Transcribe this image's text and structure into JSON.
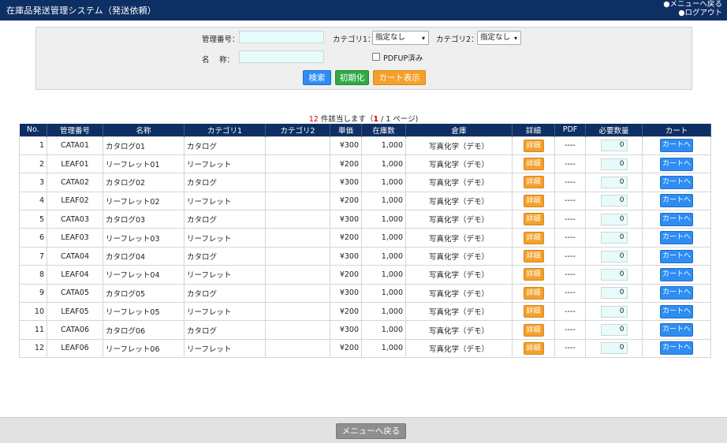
{
  "header": {
    "title": "在庫品発送管理システム（発送依頼）",
    "link_menu": "●メニューへ戻る",
    "link_logout": "●ログアウト"
  },
  "search": {
    "label_code": "管理番号：",
    "label_name": "名　 称：",
    "label_cat1": "カテゴリ1：",
    "label_cat2": "カテゴリ2：",
    "cat1_value": "指定なし",
    "cat2_value": "指定なし",
    "code_value": "",
    "name_value": "",
    "pdf_label": "PDFUP済み",
    "btn_search": "検索",
    "btn_reset": "初期化",
    "btn_cart": "カート表示"
  },
  "result": {
    "count": "12",
    "count_text": "件該当します（",
    "page": "1",
    "page_total": "/ 1 ページ)"
  },
  "table": {
    "headers": [
      "No.",
      "管理番号",
      "名称",
      "カテゴリ1",
      "カテゴリ2",
      "単価",
      "在庫数",
      "倉庫",
      "詳細",
      "PDF",
      "必要数量",
      "カート"
    ],
    "detail_label": "詳細",
    "cart_label": "カートへ",
    "rows": [
      {
        "no": "1",
        "code": "CATA01",
        "name": "カタログ01",
        "cat1": "カタログ",
        "cat2": "",
        "price": "¥300",
        "stock": "1,000",
        "warehouse": "写真化学（デモ）",
        "pdf": "----",
        "qty": "0"
      },
      {
        "no": "2",
        "code": "LEAF01",
        "name": "リーフレット01",
        "cat1": "リーフレット",
        "cat2": "",
        "price": "¥200",
        "stock": "1,000",
        "warehouse": "写真化学（デモ）",
        "pdf": "----",
        "qty": "0"
      },
      {
        "no": "3",
        "code": "CATA02",
        "name": "カタログ02",
        "cat1": "カタログ",
        "cat2": "",
        "price": "¥300",
        "stock": "1,000",
        "warehouse": "写真化学（デモ）",
        "pdf": "----",
        "qty": "0"
      },
      {
        "no": "4",
        "code": "LEAF02",
        "name": "リーフレット02",
        "cat1": "リーフレット",
        "cat2": "",
        "price": "¥200",
        "stock": "1,000",
        "warehouse": "写真化学（デモ）",
        "pdf": "----",
        "qty": "0"
      },
      {
        "no": "5",
        "code": "CATA03",
        "name": "カタログ03",
        "cat1": "カタログ",
        "cat2": "",
        "price": "¥300",
        "stock": "1,000",
        "warehouse": "写真化学（デモ）",
        "pdf": "----",
        "qty": "0"
      },
      {
        "no": "6",
        "code": "LEAF03",
        "name": "リーフレット03",
        "cat1": "リーフレット",
        "cat2": "",
        "price": "¥200",
        "stock": "1,000",
        "warehouse": "写真化学（デモ）",
        "pdf": "----",
        "qty": "0"
      },
      {
        "no": "7",
        "code": "CATA04",
        "name": "カタログ04",
        "cat1": "カタログ",
        "cat2": "",
        "price": "¥300",
        "stock": "1,000",
        "warehouse": "写真化学（デモ）",
        "pdf": "----",
        "qty": "0"
      },
      {
        "no": "8",
        "code": "LEAF04",
        "name": "リーフレット04",
        "cat1": "リーフレット",
        "cat2": "",
        "price": "¥200",
        "stock": "1,000",
        "warehouse": "写真化学（デモ）",
        "pdf": "----",
        "qty": "0"
      },
      {
        "no": "9",
        "code": "CATA05",
        "name": "カタログ05",
        "cat1": "カタログ",
        "cat2": "",
        "price": "¥300",
        "stock": "1,000",
        "warehouse": "写真化学（デモ）",
        "pdf": "----",
        "qty": "0"
      },
      {
        "no": "10",
        "code": "LEAF05",
        "name": "リーフレット05",
        "cat1": "リーフレット",
        "cat2": "",
        "price": "¥200",
        "stock": "1,000",
        "warehouse": "写真化学（デモ）",
        "pdf": "----",
        "qty": "0"
      },
      {
        "no": "11",
        "code": "CATA06",
        "name": "カタログ06",
        "cat1": "カタログ",
        "cat2": "",
        "price": "¥300",
        "stock": "1,000",
        "warehouse": "写真化学（デモ）",
        "pdf": "----",
        "qty": "0"
      },
      {
        "no": "12",
        "code": "LEAF06",
        "name": "リーフレット06",
        "cat1": "リーフレット",
        "cat2": "",
        "price": "¥200",
        "stock": "1,000",
        "warehouse": "写真化学（デモ）",
        "pdf": "----",
        "qty": "0"
      }
    ]
  },
  "footer": {
    "back_label": "メニューへ戻る"
  },
  "icons": {
    "dropdown": "chevron-down-icon"
  },
  "colors": {
    "header_bg": "#0e2f63",
    "button_blue": "#2e8df3",
    "button_green": "#30a945",
    "button_orange": "#f4a12c",
    "input_bg": "#e8fbfb",
    "highlight_red": "#d40000"
  }
}
